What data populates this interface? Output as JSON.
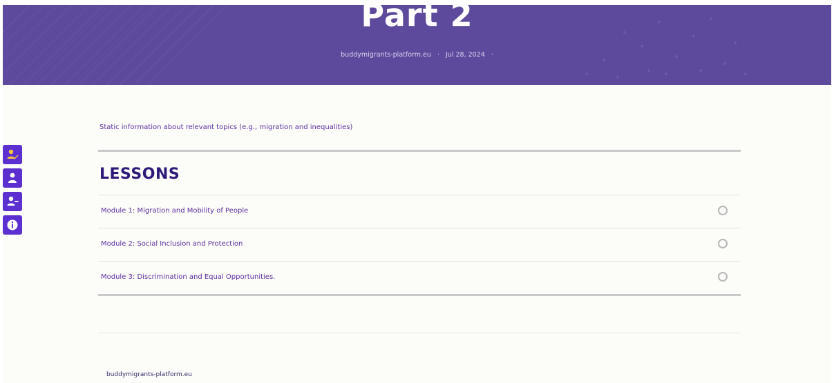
{
  "hero": {
    "title": "Part 2",
    "site": "buddymigrants-platform.eu",
    "separator": "·",
    "date": "Jul 28, 2024",
    "trailing_separator": "·",
    "background_color": "#5e4a9c"
  },
  "sidebar": {
    "buttons": [
      {
        "icon": "user-edit-icon"
      },
      {
        "icon": "user-icon"
      },
      {
        "icon": "user-minus-icon"
      },
      {
        "icon": "info-icon"
      }
    ],
    "accent_color": "#5b2fd0"
  },
  "main": {
    "intro_text": "Static information about relevant topics (e.g., migration and inequalities)",
    "lessons_heading": "LESSONS",
    "lessons": [
      {
        "label": "Module 1: Migration and Mobility of People",
        "completed": false
      },
      {
        "label": "Module 2: Social Inclusion and Protection",
        "completed": false
      },
      {
        "label": "Module 3: Discrimination and Equal Opportunities.",
        "completed": false
      }
    ]
  },
  "footer": {
    "site": "buddymigrants-platform.eu"
  }
}
